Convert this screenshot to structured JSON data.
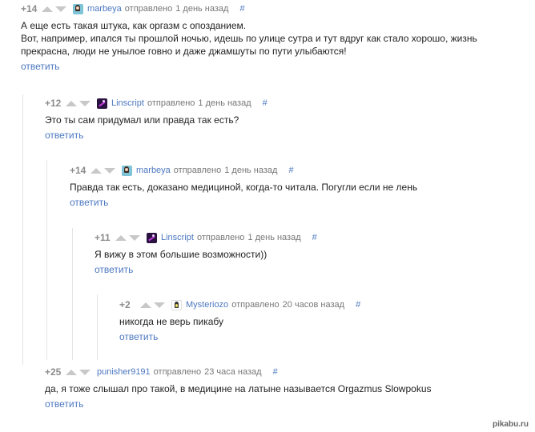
{
  "comments": [
    {
      "rating": "+14",
      "author": "marbeya",
      "avatar": "marbeya-avatar",
      "sent": "отправлено",
      "time": "1 день назад",
      "hash": "#",
      "text": "А еще есть такая штука, как оргазм с опозданием.\nВот, например, ипался ты прошлой ночью, идешь по улице сутра и тут вдруг как стало хорошо, жизнь прекрасна, люди не унылое говно и даже джамшуты по пути улыбаются!",
      "reply": "ответить"
    },
    {
      "rating": "+12",
      "author": "Linscript",
      "avatar": "linscript-avatar",
      "sent": "отправлено",
      "time": "1 день назад",
      "hash": "#",
      "text": "Это ты сам придумал или правда так есть?",
      "reply": "ответить"
    },
    {
      "rating": "+14",
      "author": "marbeya",
      "avatar": "marbeya-avatar",
      "sent": "отправлено",
      "time": "1 день назад",
      "hash": "#",
      "text": "Правда так есть, доказано медициной, когда-то читала. Погугли если не лень",
      "reply": "ответить"
    },
    {
      "rating": "+11",
      "author": "Linscript",
      "avatar": "linscript-avatar",
      "sent": "отправлено",
      "time": "1 день назад",
      "hash": "#",
      "text": "Я вижу в этом большие возможности))",
      "reply": "ответить"
    },
    {
      "rating": "+2",
      "author": "Mysteriozo",
      "avatar": "mysteriozo-avatar",
      "sent": "отправлено",
      "time": "20 часов назад",
      "hash": "#",
      "text": "никогда не верь пикабу",
      "reply": "ответить"
    },
    {
      "rating": "+25",
      "author": "punisher9191",
      "avatar": "",
      "sent": "отправлено",
      "time": "23 часа назад",
      "hash": "#",
      "text": "да, я тоже слышал про такой, в медицине на латыне называется Orgazmus Slowpokus",
      "reply": "ответить"
    }
  ],
  "watermark": "pikabu.ru"
}
